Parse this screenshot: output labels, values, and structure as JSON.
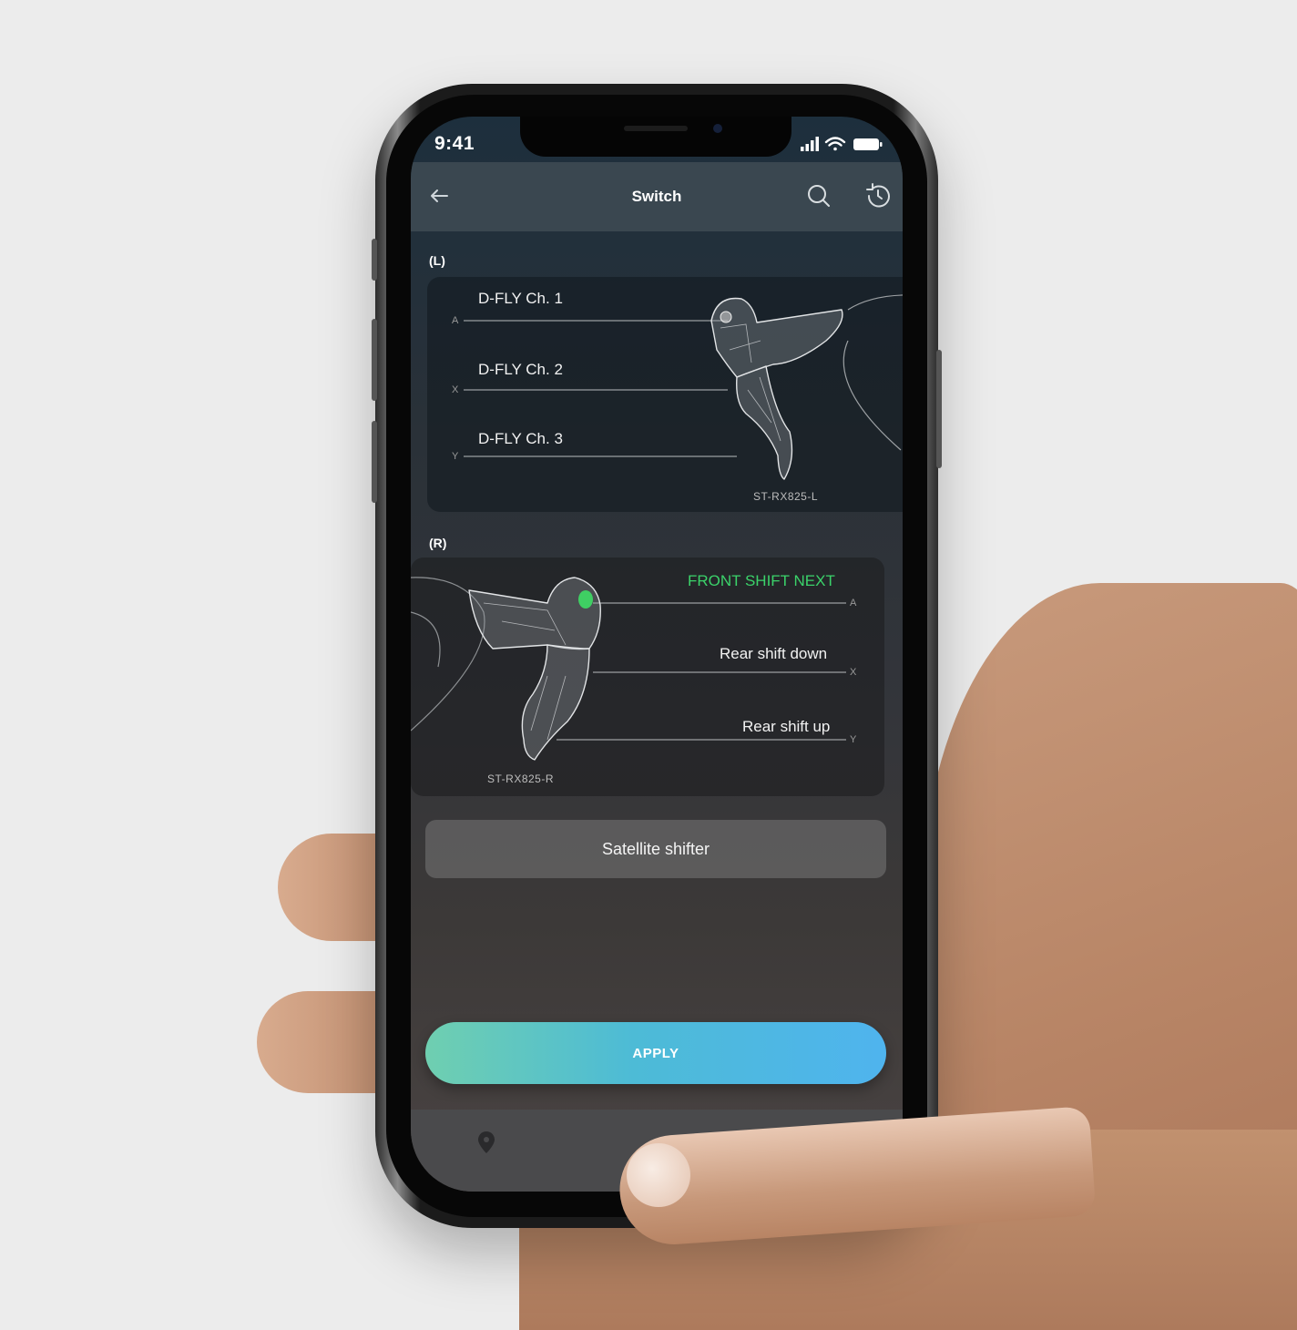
{
  "status": {
    "time": "9:41"
  },
  "header": {
    "title": "Switch"
  },
  "left": {
    "section": "(L)",
    "items": [
      {
        "key": "A",
        "label": "D-FLY Ch. 1"
      },
      {
        "key": "X",
        "label": "D-FLY Ch. 2"
      },
      {
        "key": "Y",
        "label": "D-FLY Ch. 3"
      }
    ],
    "model": "ST-RX825-L"
  },
  "right": {
    "section": "(R)",
    "items": [
      {
        "key": "A",
        "label": "FRONT SHIFT NEXT"
      },
      {
        "key": "X",
        "label": "Rear shift down"
      },
      {
        "key": "Y",
        "label": "Rear shift up"
      }
    ],
    "model": "ST-RX825-R"
  },
  "satellite_button": "Satellite shifter",
  "apply_button": "APPLY",
  "colors": {
    "accent_green": "#3bd26a",
    "apply_gradient_start": "#6fcfb0",
    "apply_gradient_end": "#4fb4ee"
  },
  "icons": [
    "back-arrow-icon",
    "search-icon",
    "history-icon",
    "location-pin-icon"
  ]
}
